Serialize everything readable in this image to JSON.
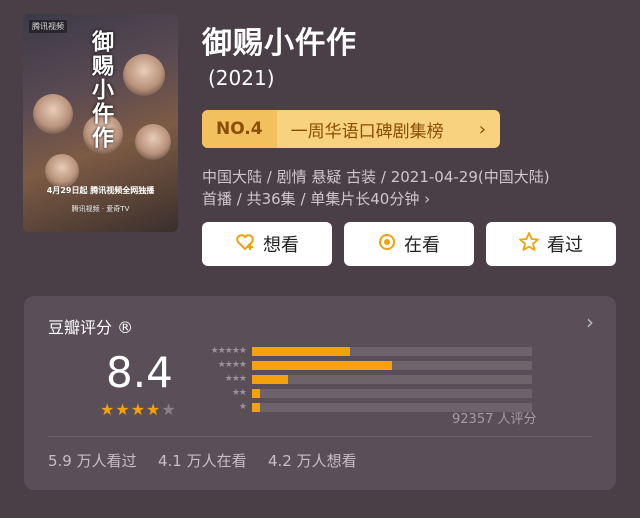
{
  "poster": {
    "logo": "腾讯视频",
    "vertical_title": "御赐小仵作",
    "air_text": "4月29日起 腾讯视频全网独播",
    "platforms": "腾讯视频 · 爱奇TV"
  },
  "title": "御赐小仵作",
  "year": "(2021)",
  "rank": {
    "no": "NO.4",
    "name": "一周华语口碑剧集榜",
    "chevron": "›"
  },
  "meta": {
    "line1": "中国大陆 / 剧情 悬疑 古装 / 2021-04-29(中国大陆)",
    "line2": "首播 / 共36集 / 单集片长40分钟 ›"
  },
  "buttons": {
    "want": "想看",
    "watching": "在看",
    "watched": "看过"
  },
  "rating": {
    "label": "豆瓣评分 ®",
    "score": "8.4",
    "stars": [
      1,
      1,
      1,
      1,
      0.5
    ],
    "distribution": [
      {
        "stars": "★★★★★",
        "fraction": 0.35
      },
      {
        "stars": "★★★★",
        "fraction": 0.5
      },
      {
        "stars": "★★★",
        "fraction": 0.13
      },
      {
        "stars": "★★",
        "fraction": 0.03
      },
      {
        "stars": "★",
        "fraction": 0.03
      }
    ],
    "count": "92357 人评分"
  },
  "stats": {
    "watched": "5.9 万人看过",
    "watching": "4.1 万人在看",
    "want": "4.2 万人想看"
  },
  "colors": {
    "accent": "#f4a10c",
    "rank_bg": "#f8d27e",
    "bg": "#4a3f47"
  }
}
